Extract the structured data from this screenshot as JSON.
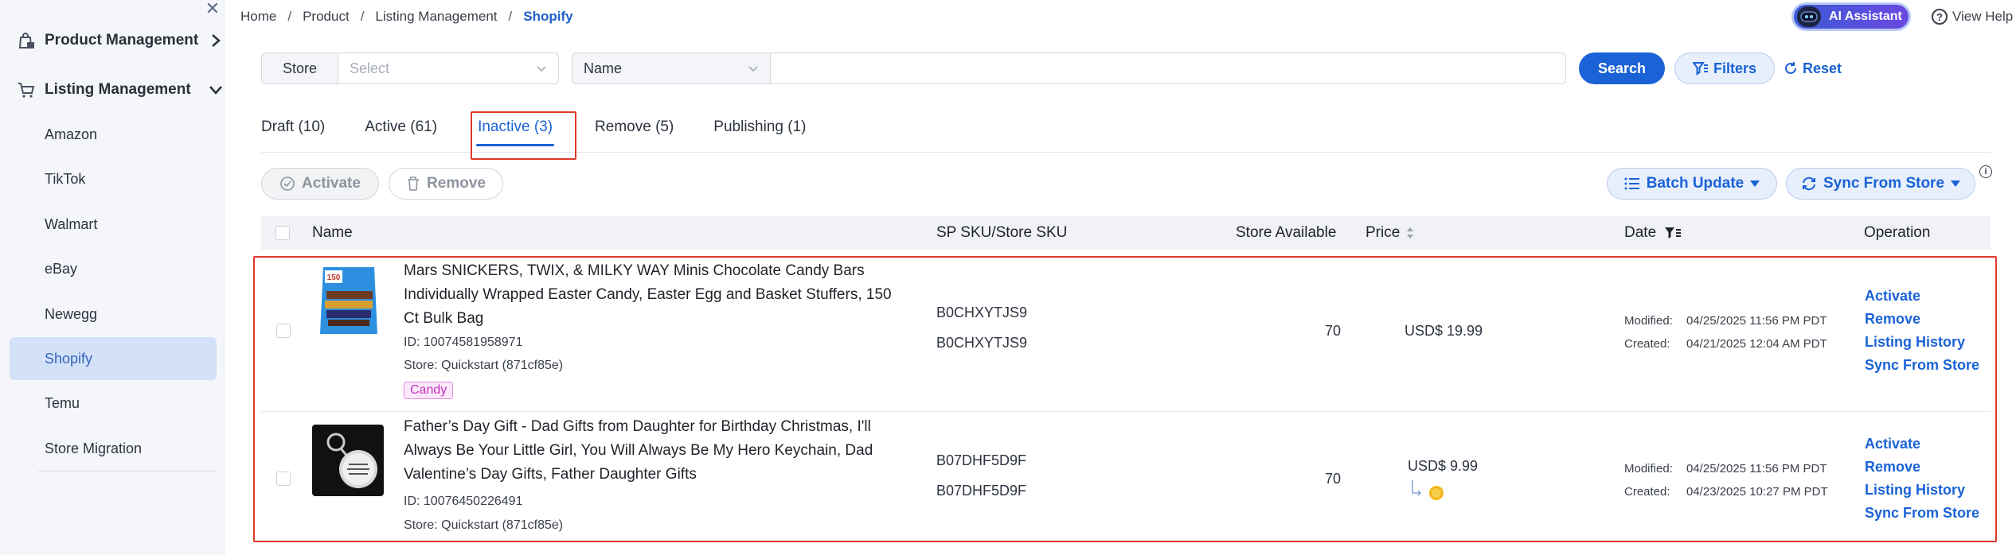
{
  "sidebar": {
    "groups": [
      {
        "label": "Product Management",
        "icon": "bag-lock-icon"
      },
      {
        "label": "Listing Management",
        "icon": "cart-icon"
      }
    ],
    "items": [
      {
        "label": "Amazon"
      },
      {
        "label": "TikTok"
      },
      {
        "label": "Walmart"
      },
      {
        "label": "eBay"
      },
      {
        "label": "Newegg"
      },
      {
        "label": "Shopify"
      },
      {
        "label": "Temu"
      },
      {
        "label": "Store Migration"
      }
    ],
    "active_item": "Shopify"
  },
  "breadcrumb": [
    "Home",
    "Product",
    "Listing Management",
    "Shopify"
  ],
  "header": {
    "ai_label": "AI Assistant",
    "help_label": "View Help"
  },
  "filters": {
    "store_label": "Store",
    "store_placeholder": "Select",
    "field_select": "Name",
    "search_value": "",
    "search_label": "Search",
    "filters_label": "Filters",
    "reset_label": "Reset"
  },
  "tabs": [
    {
      "label": "Draft (10)"
    },
    {
      "label": "Active (61)"
    },
    {
      "label": "Inactive (3)"
    },
    {
      "label": "Remove (5)"
    },
    {
      "label": "Publishing (1)"
    }
  ],
  "active_tab": "Inactive (3)",
  "actions": {
    "activate": "Activate",
    "remove": "Remove",
    "batch_update": "Batch Update",
    "sync_from_store": "Sync From Store"
  },
  "table": {
    "columns": {
      "name": "Name",
      "sku": "SP SKU/Store SKU",
      "available": "Store Available",
      "price": "Price",
      "date": "Date",
      "operation": "Operation"
    },
    "rows": [
      {
        "title_lines": [
          "Mars SNICKERS, TWIX, & MILKY WAY Minis Chocolate Candy Bars",
          "Individually Wrapped Easter Candy, Easter Egg and Basket Stuffers, 150",
          "Ct Bulk Bag"
        ],
        "id": "ID: 10074581958971",
        "store": "Store: Quickstart (871cf85e)",
        "tag": "Candy",
        "sp_sku": "B0CHXYTJS9",
        "store_sku": "B0CHXYTJS9",
        "available": "70",
        "price": "USD$ 19.99",
        "modified_label": "Modified:",
        "modified": "04/25/2025 11:56 PM PDT",
        "created_label": "Created:",
        "created": "04/21/2025 12:04 AM PDT",
        "ops": [
          "Activate",
          "Remove",
          "Listing History",
          "Sync From Store"
        ]
      },
      {
        "title_lines": [
          "Father’s Day Gift - Dad Gifts from Daughter for Birthday Christmas, I'll",
          "Always Be Your Little Girl, You Will Always Be My Hero Keychain, Dad",
          "Valentine’s Day Gifts, Father Daughter Gifts"
        ],
        "id": "ID: 10076450226491",
        "store": "Store: Quickstart (871cf85e)",
        "sp_sku": "B07DHF5D9F",
        "store_sku": "B07DHF5D9F",
        "available": "70",
        "price": "USD$ 9.99",
        "modified_label": "Modified:",
        "modified": "04/25/2025 11:56 PM PDT",
        "created_label": "Created:",
        "created": "04/23/2025 10:27 PM PDT",
        "ops": [
          "Activate",
          "Remove",
          "Listing History",
          "Sync From Store"
        ]
      }
    ]
  },
  "colors": {
    "primary": "#1a62d6",
    "highlight_border": "#e0382c",
    "sidebar_active": "#d3e2f9",
    "tag_text": "#c133be"
  }
}
